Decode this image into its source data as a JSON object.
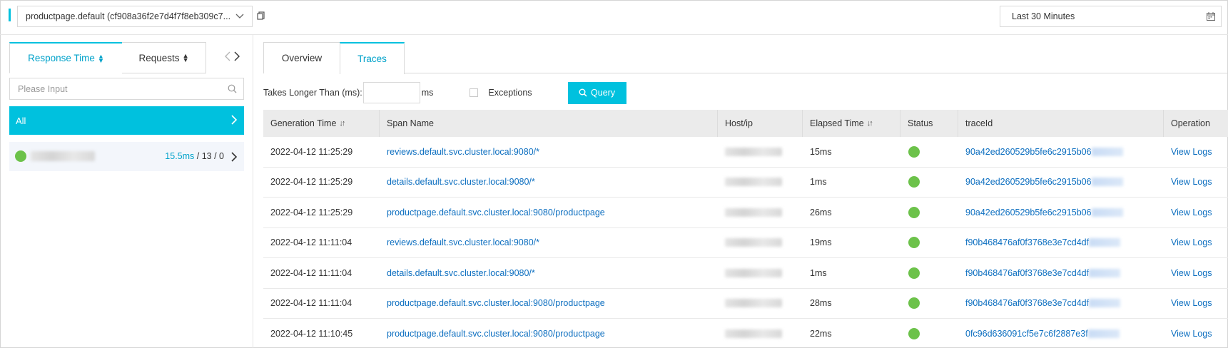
{
  "header": {
    "app_selector": {
      "value": "productpage.default (cf908a36f2e7d4f7f8eb309c7..."
    },
    "time_range": {
      "value": "Last 30 Minutes"
    }
  },
  "left_panel": {
    "tabs": [
      {
        "label": "Response Time"
      },
      {
        "label": "Requests"
      }
    ],
    "search": {
      "placeholder": "Please Input"
    },
    "all_item": {
      "label": "All"
    },
    "host_item": {
      "avg": "15.5ms",
      "rest": " / 13 / 0"
    }
  },
  "right_panel": {
    "tabs": [
      {
        "label": "Overview"
      },
      {
        "label": "Traces"
      }
    ],
    "filters": {
      "takes_longer_label": "Takes Longer Than (ms):",
      "unit": "ms",
      "exceptions_label": "Exceptions",
      "query_button": "Query"
    },
    "table": {
      "columns": [
        "Generation Time",
        "Span Name",
        "Host/ip",
        "Elapsed Time",
        "Status",
        "traceId",
        "Operation"
      ],
      "rows": [
        {
          "time": "2022-04-12 11:25:29",
          "span": "reviews.default.svc.cluster.local:9080/*",
          "elapsed": "15ms",
          "trace": "90a42ed260529b5fe6c2915b06",
          "op": "View Logs"
        },
        {
          "time": "2022-04-12 11:25:29",
          "span": "details.default.svc.cluster.local:9080/*",
          "elapsed": "1ms",
          "trace": "90a42ed260529b5fe6c2915b06",
          "op": "View Logs"
        },
        {
          "time": "2022-04-12 11:25:29",
          "span": "productpage.default.svc.cluster.local:9080/productpage",
          "elapsed": "26ms",
          "trace": "90a42ed260529b5fe6c2915b06",
          "op": "View Logs"
        },
        {
          "time": "2022-04-12 11:11:04",
          "span": "reviews.default.svc.cluster.local:9080/*",
          "elapsed": "19ms",
          "trace": "f90b468476af0f3768e3e7cd4df",
          "op": "View Logs"
        },
        {
          "time": "2022-04-12 11:11:04",
          "span": "details.default.svc.cluster.local:9080/*",
          "elapsed": "1ms",
          "trace": "f90b468476af0f3768e3e7cd4df",
          "op": "View Logs"
        },
        {
          "time": "2022-04-12 11:11:04",
          "span": "productpage.default.svc.cluster.local:9080/productpage",
          "elapsed": "28ms",
          "trace": "f90b468476af0f3768e3e7cd4df",
          "op": "View Logs"
        },
        {
          "time": "2022-04-12 11:10:45",
          "span": "productpage.default.svc.cluster.local:9080/productpage",
          "elapsed": "22ms",
          "trace": "0fc96d636091cf5e7c6f2887e3f",
          "op": "View Logs"
        }
      ]
    }
  },
  "colors": {
    "accent": "#00c1de",
    "link": "#0d6fc0",
    "status_ok": "#6cc24a"
  }
}
